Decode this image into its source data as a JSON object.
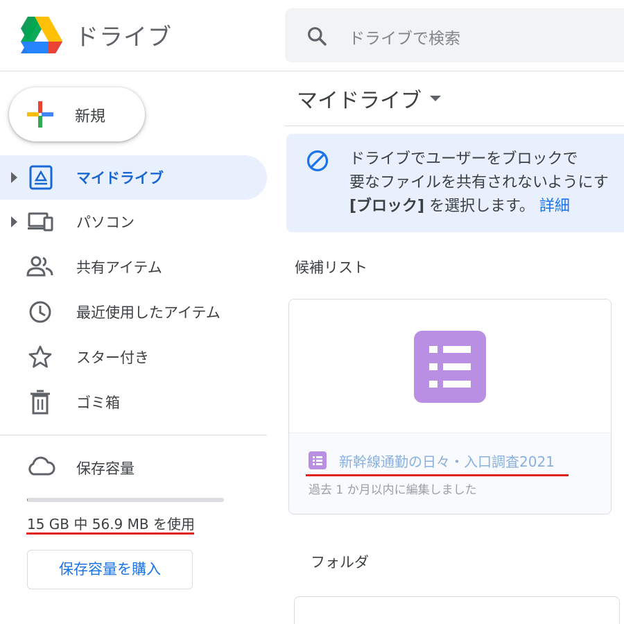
{
  "header": {
    "app_name": "ドライブ",
    "logo_icon": "google-drive-logo",
    "search": {
      "placeholder": "ドライブで検索",
      "icon": "search-icon"
    }
  },
  "sidebar": {
    "new_button": {
      "label": "新規",
      "icon": "plus-icon"
    },
    "items": [
      {
        "label": "マイドライブ",
        "icon": "my-drive-icon",
        "active": true,
        "expandable": true
      },
      {
        "label": "パソコン",
        "icon": "computers-icon",
        "active": false,
        "expandable": true
      },
      {
        "label": "共有アイテム",
        "icon": "shared-people-icon",
        "active": false,
        "expandable": false
      },
      {
        "label": "最近使用したアイテム",
        "icon": "clock-icon",
        "active": false,
        "expandable": false
      },
      {
        "label": "スター付き",
        "icon": "star-icon",
        "active": false,
        "expandable": false
      },
      {
        "label": "ゴミ箱",
        "icon": "trash-icon",
        "active": false,
        "expandable": false
      }
    ],
    "storage": {
      "label": "保存容量",
      "icon": "cloud-icon",
      "usage_text": "15 GB 中 56.9 MB を使用",
      "used_fraction": 0.004,
      "buy_button": "保存容量を購入"
    }
  },
  "main": {
    "title": "マイドライブ",
    "banner": {
      "icon": "block-icon",
      "line1": "ドライブでユーザーをブロックで",
      "line2": "要なファイルを共有されないようにす",
      "line3_bold": "[ブロック]",
      "line3_rest": " を選択します。",
      "link": "詳細"
    },
    "suggested": {
      "label": "候補リスト",
      "files": [
        {
          "name": "新幹線通勤の日々・入口調査2021",
          "meta": "過去 1 か月以内に編集しました",
          "type_icon": "google-forms-icon"
        }
      ]
    },
    "folders": {
      "label": "フォルダ"
    }
  },
  "colors": {
    "accent_blue": "#1a73e8",
    "active_bg": "#e8f0fe",
    "forms_purple": "#b98fe3",
    "annotation_red": "#e0201b"
  }
}
